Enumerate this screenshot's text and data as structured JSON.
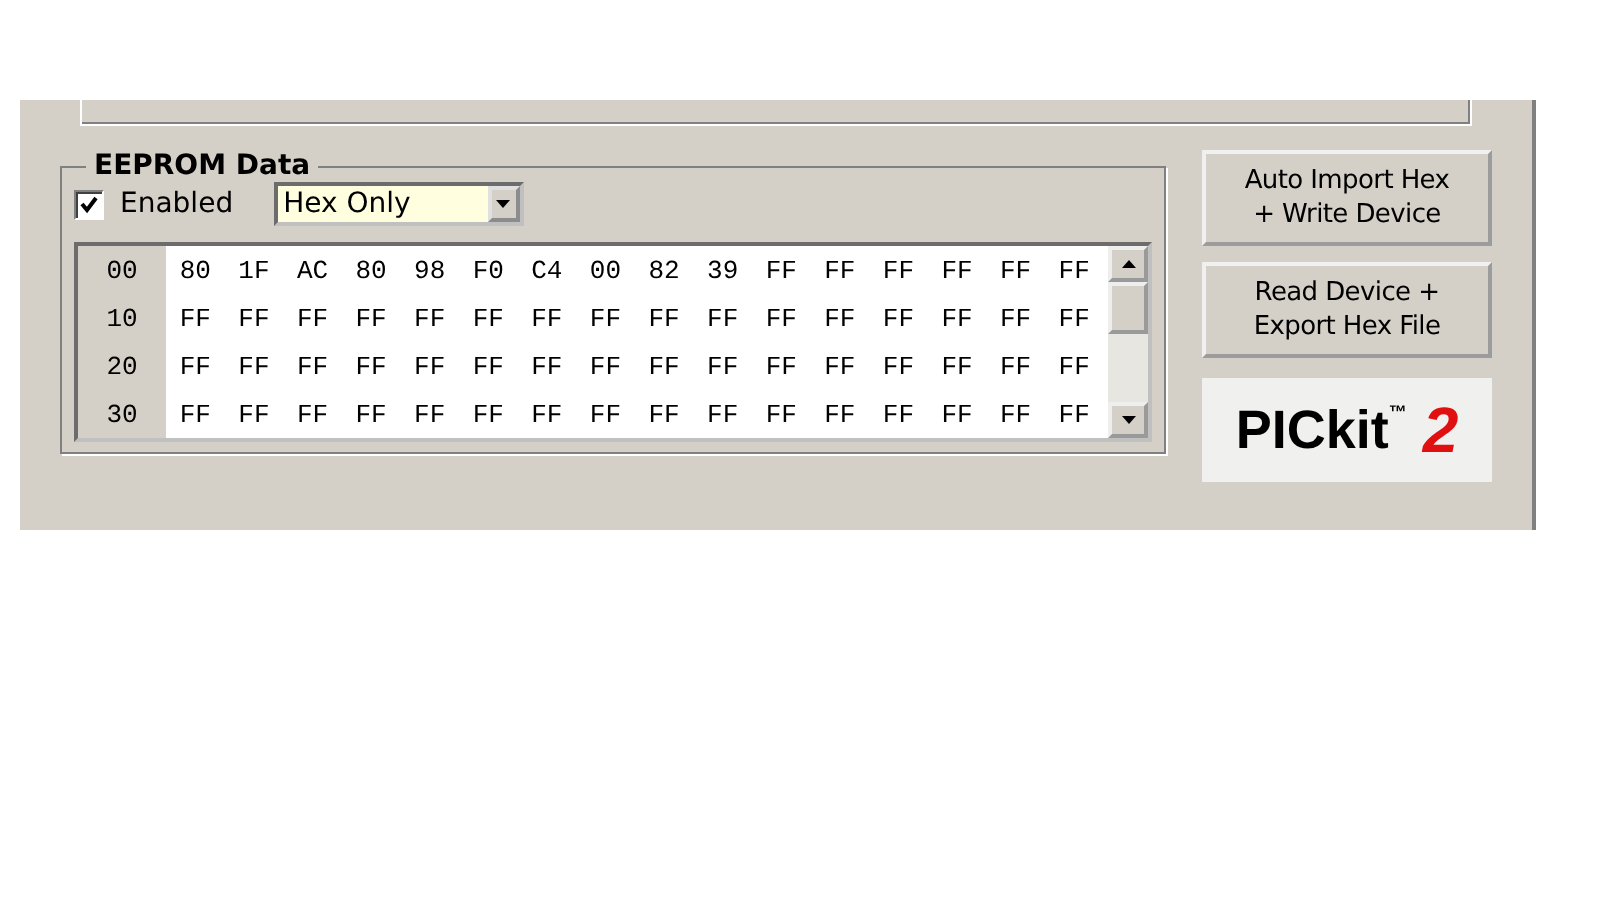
{
  "eeprom": {
    "title": "EEPROM Data",
    "enabled": {
      "label": "Enabled",
      "checked": true
    },
    "mode": {
      "value": "Hex Only"
    },
    "rows": [
      {
        "address": "00",
        "bytes": [
          "80",
          "1F",
          "AC",
          "80",
          "98",
          "F0",
          "C4",
          "00",
          "82",
          "39",
          "FF",
          "FF",
          "FF",
          "FF",
          "FF",
          "FF"
        ]
      },
      {
        "address": "10",
        "bytes": [
          "FF",
          "FF",
          "FF",
          "FF",
          "FF",
          "FF",
          "FF",
          "FF",
          "FF",
          "FF",
          "FF",
          "FF",
          "FF",
          "FF",
          "FF",
          "FF"
        ]
      },
      {
        "address": "20",
        "bytes": [
          "FF",
          "FF",
          "FF",
          "FF",
          "FF",
          "FF",
          "FF",
          "FF",
          "FF",
          "FF",
          "FF",
          "FF",
          "FF",
          "FF",
          "FF",
          "FF"
        ]
      },
      {
        "address": "30",
        "bytes": [
          "FF",
          "FF",
          "FF",
          "FF",
          "FF",
          "FF",
          "FF",
          "FF",
          "FF",
          "FF",
          "FF",
          "FF",
          "FF",
          "FF",
          "FF",
          "FF"
        ]
      }
    ]
  },
  "buttons": [
    {
      "lines": [
        "Auto Import Hex",
        "+ Write Device"
      ]
    },
    {
      "lines": [
        "Read Device +",
        "Export Hex File"
      ]
    }
  ],
  "logo": {
    "name": "PICkit",
    "mark": "™",
    "number": "2"
  }
}
